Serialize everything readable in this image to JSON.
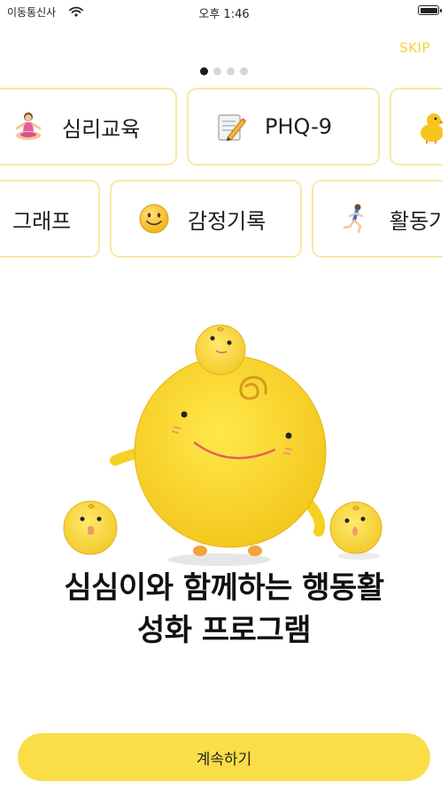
{
  "status_bar": {
    "carrier": "이동통신사",
    "time": "오후 1:46"
  },
  "header": {
    "skip_label": "SKIP"
  },
  "pagination": {
    "total": 4,
    "current": 1
  },
  "feature_row_1": [
    {
      "label": "심리교육",
      "icon": "meditation-icon"
    },
    {
      "label": "PHQ-9",
      "icon": "memo-pencil-icon"
    },
    {
      "label": "",
      "icon": "chick-icon"
    }
  ],
  "feature_row_2": [
    {
      "label": "그래프",
      "icon": ""
    },
    {
      "label": "감정기록",
      "icon": "smiley-icon"
    },
    {
      "label": "활동기",
      "icon": "running-icon"
    }
  ],
  "hero": {
    "illustration": "simsimi-mascot-group"
  },
  "headline": {
    "line1": "심심이와 함께하는 행동활",
    "line2": "성화 프로그램"
  },
  "continue_button": {
    "label": "계속하기"
  },
  "colors": {
    "accent": "#fbde47",
    "card_border": "#f7e9a8",
    "skip": "#f4cf38"
  }
}
